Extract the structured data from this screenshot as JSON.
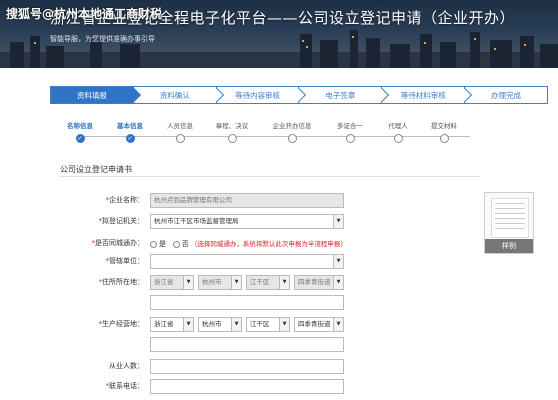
{
  "watermark": "搜狐号@杭州本地通工商财税",
  "banner": {
    "title": "浙江省企业登记全程电子化平台——公司设立登记申请（企业开办）",
    "subtitle": "智能导服，为您提供准确办事引导"
  },
  "process_steps": [
    {
      "label": "资料填报",
      "active": true
    },
    {
      "label": "资料确认",
      "active": false
    },
    {
      "label": "等待内容审核",
      "active": false
    },
    {
      "label": "电子签章",
      "active": false
    },
    {
      "label": "等待材料审核",
      "active": false
    },
    {
      "label": "办理完成",
      "active": false
    }
  ],
  "sub_steps": [
    {
      "label": "名称信息",
      "done": true
    },
    {
      "label": "基本信息",
      "done": true
    },
    {
      "label": "人员信息",
      "done": false
    },
    {
      "label": "章程、决议",
      "done": false
    },
    {
      "label": "企业开办信息",
      "done": false
    },
    {
      "label": "多证合一",
      "done": false
    },
    {
      "label": "代理人",
      "done": false
    },
    {
      "label": "提交材料",
      "done": false
    }
  ],
  "form": {
    "title": "公司设立登记申请书",
    "company_name": {
      "label": "*企业名称：",
      "value": "杭州点到品牌管理有限公司"
    },
    "registry_office": {
      "label": "*拟登记机关：",
      "value": "杭州市江干区市场监督管理局"
    },
    "cross_region": {
      "label": "*是否同城通办：",
      "yes": "是",
      "no": "否",
      "note": "（选择同城通办，系统将默认此次申报为半流程申报）"
    },
    "supervisor": {
      "label": "*管辖单位：",
      "value": ""
    },
    "residence": {
      "label": "*住所所在地：",
      "province": "浙江省",
      "city": "杭州市",
      "district": "江干区",
      "street": "四季青街道",
      "detail": ""
    },
    "business_address": {
      "label": "*生产经营地：",
      "province": "浙江省",
      "city": "杭州市",
      "district": "江干区",
      "street": "四季青街道",
      "detail": ""
    },
    "employees": {
      "label": "从业人数：",
      "value": ""
    },
    "phone": {
      "label": "*联系电话：",
      "value": ""
    }
  },
  "sample": {
    "label": "样例"
  }
}
